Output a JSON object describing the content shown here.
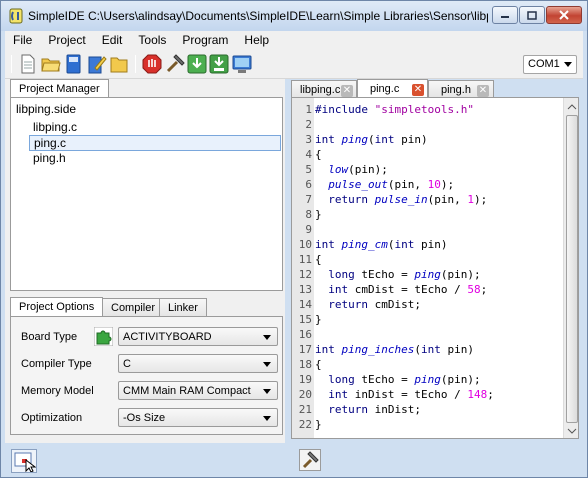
{
  "window": {
    "title": "SimpleIDE C:\\Users\\alindsay\\Documents\\SimpleIDE\\Learn\\Simple Libraries\\Sensor\\libping\\li..."
  },
  "menu": [
    "File",
    "Project",
    "Edit",
    "Tools",
    "Program",
    "Help"
  ],
  "toolbar": {
    "icons": [
      "new-file",
      "open-folder",
      "save",
      "edit",
      "folder",
      "stop",
      "build",
      "load-ram",
      "load-eeprom",
      "run-terminal"
    ],
    "com_port": "COM1"
  },
  "project_manager": {
    "tab": "Project Manager",
    "project": "libping.side",
    "files": [
      "libping.c",
      "ping.c",
      "ping.h"
    ],
    "selected_index": 1
  },
  "options": {
    "tabs": [
      "Project Options",
      "Compiler",
      "Linker"
    ],
    "rows": [
      {
        "label": "Board Type",
        "value": "ACTIVITYBOARD"
      },
      {
        "label": "Compiler Type",
        "value": "C"
      },
      {
        "label": "Memory Model",
        "value": "CMM Main RAM Compact"
      },
      {
        "label": "Optimization",
        "value": "-Os Size"
      }
    ]
  },
  "editor": {
    "tabs": [
      {
        "label": "libping.c",
        "active": false
      },
      {
        "label": "ping.c",
        "active": true
      },
      {
        "label": "ping.h",
        "active": false
      }
    ],
    "lines": [
      {
        "n": "1",
        "code": "#include \"simpletools.h\""
      },
      {
        "n": "2",
        "code": ""
      },
      {
        "n": "3",
        "code": "int ping(int pin)"
      },
      {
        "n": "4",
        "code": "{"
      },
      {
        "n": "5",
        "code": "  low(pin);"
      },
      {
        "n": "6",
        "code": "  pulse_out(pin, 10);"
      },
      {
        "n": "7",
        "code": "  return pulse_in(pin, 1);"
      },
      {
        "n": "8",
        "code": "}"
      },
      {
        "n": "9",
        "code": ""
      },
      {
        "n": "10",
        "code": "int ping_cm(int pin)"
      },
      {
        "n": "11",
        "code": "{"
      },
      {
        "n": "12",
        "code": "  long tEcho = ping(pin);"
      },
      {
        "n": "13",
        "code": "  int cmDist = tEcho / 58;"
      },
      {
        "n": "14",
        "code": "  return cmDist;"
      },
      {
        "n": "15",
        "code": "}"
      },
      {
        "n": "16",
        "code": ""
      },
      {
        "n": "17",
        "code": "int ping_inches(int pin)"
      },
      {
        "n": "18",
        "code": "{"
      },
      {
        "n": "19",
        "code": "  long tEcho = ping(pin);"
      },
      {
        "n": "20",
        "code": "  int inDist = tEcho / 148;"
      },
      {
        "n": "21",
        "code": "  return inDist;"
      },
      {
        "n": "22",
        "code": "}"
      }
    ]
  },
  "colors": {
    "window_frame": "#cfdff1",
    "keyword": "#000080",
    "function": "#0000c0",
    "string": "#a000a0",
    "number": "#e000e0",
    "tab_close_active": "#d9512f"
  }
}
